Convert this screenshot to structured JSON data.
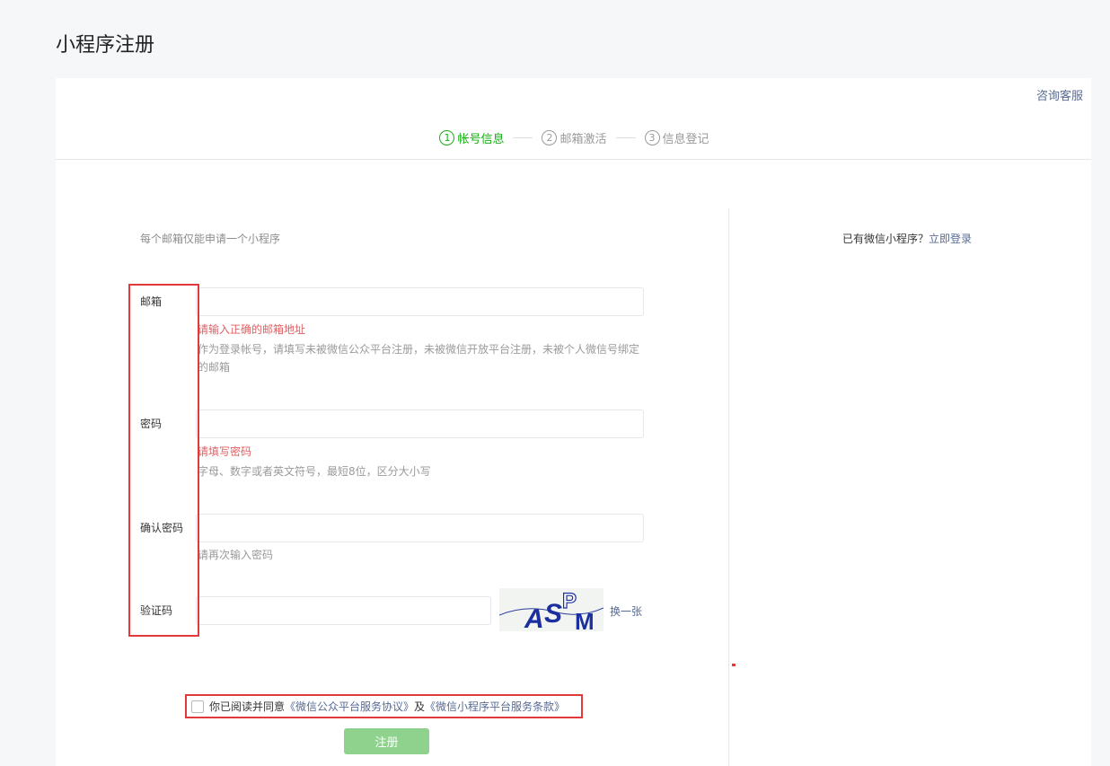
{
  "page": {
    "title": "小程序注册"
  },
  "header": {
    "help_link": "咨询客服"
  },
  "steps": [
    {
      "num": "1",
      "label": "帐号信息",
      "active": true
    },
    {
      "num": "2",
      "label": "邮箱激活",
      "active": false
    },
    {
      "num": "3",
      "label": "信息登记",
      "active": false
    }
  ],
  "form": {
    "tip": "每个邮箱仅能申请一个小程序",
    "email": {
      "label": "邮箱",
      "value": "",
      "error": "请输入正确的邮箱地址",
      "hint": "作为登录帐号，请填写未被微信公众平台注册，未被微信开放平台注册，未被个人微信号绑定的邮箱"
    },
    "password": {
      "label": "密码",
      "value": "",
      "error": "请填写密码",
      "hint": "字母、数字或者英文符号，最短8位，区分大小写"
    },
    "confirm_password": {
      "label": "确认密码",
      "value": "",
      "hint": "请再次输入密码"
    },
    "captcha": {
      "label": "验证码",
      "value": "",
      "image_text": "ASPM",
      "refresh_link": "换一张"
    },
    "agreement": {
      "prefix": "你已阅读并同意",
      "link1": "《微信公众平台服务协议》",
      "middle": "及",
      "link2": "《微信小程序平台服务条款》",
      "checked": false
    },
    "submit_label": "注册"
  },
  "sidebar": {
    "login_prompt": "已有微信小程序？",
    "login_link": "立即登录"
  },
  "colors": {
    "accent_green": "#1aad19",
    "link_blue": "#576b95",
    "error_red": "#e15f63",
    "highlight_red": "#e23a3a",
    "submit_disabled": "#8fd28e"
  }
}
